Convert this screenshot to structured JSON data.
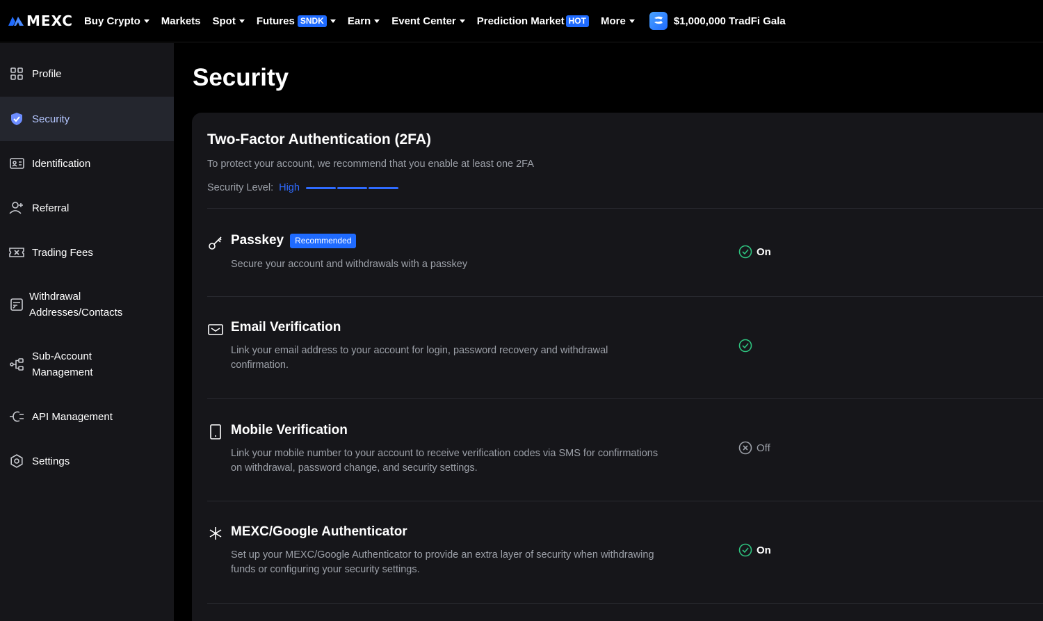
{
  "brand": {
    "name": "MEXC",
    "color": "#1f6bff"
  },
  "nav": {
    "items": [
      {
        "label": "Buy Crypto",
        "dropdown": true
      },
      {
        "label": "Markets",
        "dropdown": false
      },
      {
        "label": "Spot",
        "dropdown": true
      },
      {
        "label": "Futures",
        "badge": "SNDK",
        "dropdown": true
      },
      {
        "label": "Earn",
        "dropdown": true
      },
      {
        "label": "Event Center",
        "dropdown": true
      },
      {
        "label": "Prediction Market",
        "badge": "HOT",
        "dropdown": false
      },
      {
        "label": "More",
        "dropdown": true
      }
    ],
    "promo": "$1,000,000 TradFi Gala"
  },
  "sidebar": {
    "items": [
      {
        "label": "Profile",
        "icon": "grid-icon",
        "active": false
      },
      {
        "label": "Security",
        "icon": "shield-check-icon",
        "active": true
      },
      {
        "label": "Identification",
        "icon": "id-card-icon",
        "active": false
      },
      {
        "label": "Referral",
        "icon": "user-plus-icon",
        "active": false
      },
      {
        "label": "Trading Fees",
        "icon": "ticket-icon",
        "active": false
      },
      {
        "label": "Withdrawal Addresses/Contacts",
        "label_line1": "Withdrawal",
        "label_line2": "Addresses/Contacts",
        "icon": "address-book-icon",
        "active": false
      },
      {
        "label": "Sub-Account Management",
        "label_line1": "Sub-Account",
        "label_line2": "Management",
        "icon": "sub-account-icon",
        "active": false
      },
      {
        "label": "API Management",
        "icon": "api-icon",
        "active": false
      },
      {
        "label": "Settings",
        "icon": "gear-icon",
        "active": false
      }
    ]
  },
  "page": {
    "title": "Security"
  },
  "twofa": {
    "title": "Two-Factor Authentication (2FA)",
    "subtitle": "To protect your account, we recommend that you enable at least one 2FA",
    "level_label": "Security Level:",
    "level_value": "High",
    "level_segments": 3,
    "items": [
      {
        "title": "Passkey",
        "badge": "Recommended",
        "desc": "Secure your account and withdrawals with a passkey",
        "icon": "key-icon",
        "status": "On"
      },
      {
        "title": "Email Verification",
        "desc": "Link your email address to your account for login, password recovery and withdrawal confirmation.",
        "icon": "email-icon",
        "status": ""
      },
      {
        "title": "Mobile Verification",
        "desc": "Link your mobile number to your account to receive verification codes via SMS for confirmations on withdrawal, password change, and security settings.",
        "icon": "mobile-icon",
        "status": "Off"
      },
      {
        "title": "MEXC/Google Authenticator",
        "desc": "Set up your MEXC/Google Authenticator to provide an extra layer of security when withdrawing funds or configuring your security settings.",
        "icon": "asterisk-icon",
        "status": "On"
      }
    ]
  },
  "colors": {
    "on": "#2ec27e",
    "off": "#9ca0a8",
    "accent": "#1f6bff",
    "active_label": "#b4c6ff"
  }
}
